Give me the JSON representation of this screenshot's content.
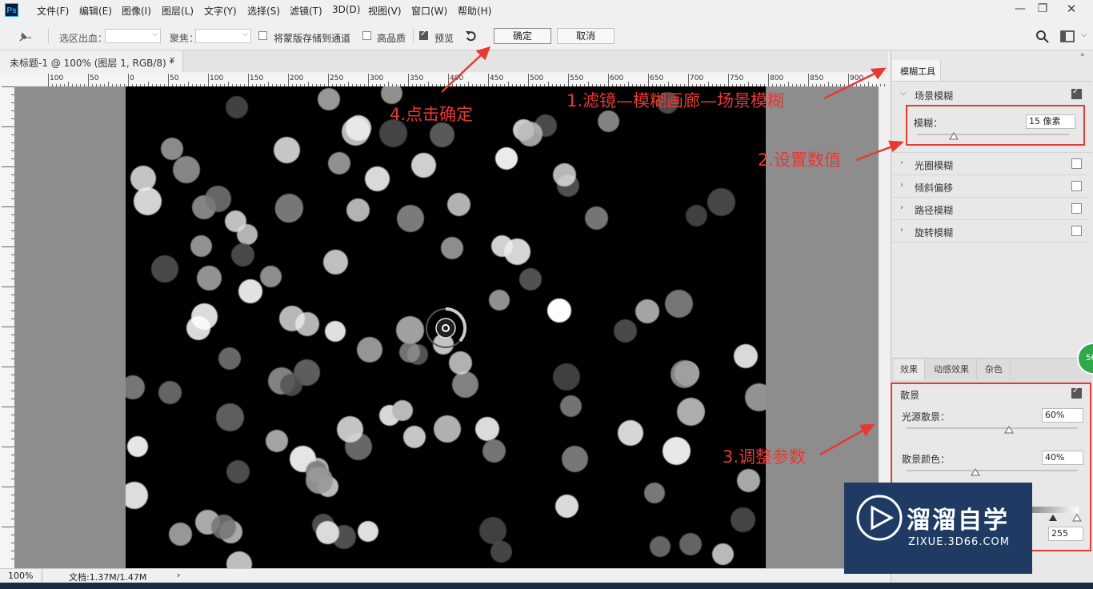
{
  "app": {
    "logo": "Ps"
  },
  "menu": [
    "文件(F)",
    "编辑(E)",
    "图像(I)",
    "图层(L)",
    "文字(Y)",
    "选择(S)",
    "滤镜(T)",
    "3D(D)",
    "视图(V)",
    "窗口(W)",
    "帮助(H)"
  ],
  "window_controls": {
    "minimize": "—",
    "restore": "❐",
    "close": "✕"
  },
  "options": {
    "selection_bleed_label": "选区出血：",
    "focus_label": "聚焦：",
    "save_mask_label": "将蒙版存储到通道",
    "high_quality_label": "高品质",
    "preview_label": "预览",
    "ok_label": "确定",
    "cancel_label": "取消"
  },
  "document_tab": {
    "title": "未标题-1 @ 100% (图层 1, RGB/8) *",
    "close": "✕"
  },
  "ruler_h_labels": [
    "100",
    "50",
    "0",
    "50",
    "100",
    "150",
    "200",
    "250",
    "300",
    "350",
    "400",
    "450",
    "500",
    "550",
    "600",
    "650",
    "700",
    "750",
    "800",
    "850",
    "900"
  ],
  "status": {
    "zoom": "100%",
    "doc_info": "文档:1.37M/1.47M"
  },
  "blur_panel": {
    "header": "模糊工具",
    "field_blur": {
      "label": "场景模糊",
      "checked": true,
      "blur_label": "模糊：",
      "blur_value": "15 像素",
      "slider_level": 0.24
    },
    "items": [
      {
        "label": "光圈模糊",
        "checked": false
      },
      {
        "label": "倾斜偏移",
        "checked": false
      },
      {
        "label": "路径模糊",
        "checked": false
      },
      {
        "label": "旋转模糊",
        "checked": false
      }
    ]
  },
  "effects_panel": {
    "tabs": [
      "效果",
      "动感效果",
      "杂色"
    ],
    "bokeh_label": "散景",
    "bokeh_checked": true,
    "light_bokeh_label": "光源散景：",
    "light_bokeh_value": "60%",
    "light_bokeh_level": 0.6,
    "bokeh_color_label": "散景颜色：",
    "bokeh_color_value": "40%",
    "bokeh_color_level": 0.4,
    "light_range_max": "255"
  },
  "annotations": {
    "step1": "1.滤镜—模糊画廊—场景模糊",
    "step2": "2.设置数值",
    "step3": "3.调整参数",
    "step4": "4.点击确定"
  },
  "watermark": {
    "brand": "溜溜自学",
    "url": "ZIXUE.3D66.COM"
  },
  "badge": "56",
  "colors": {
    "annotation_red": "#e53935",
    "canvas_bg": "#000000",
    "watermark_bg": "#1f3a63"
  }
}
